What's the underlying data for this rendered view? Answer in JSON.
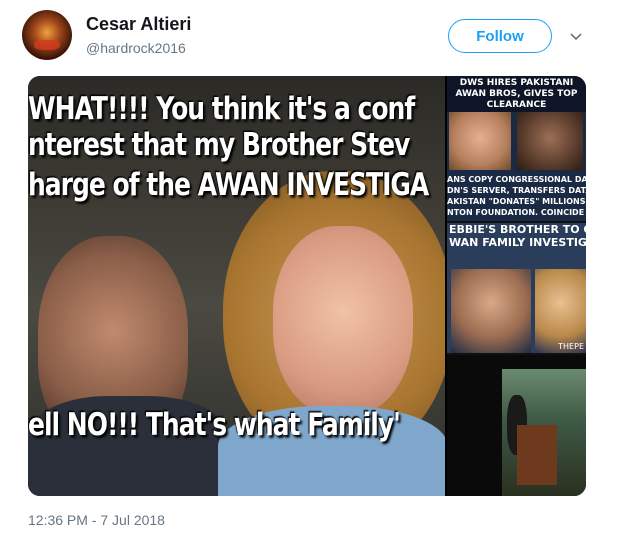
{
  "tweet": {
    "author_name": "Cesar Altieri",
    "author_handle": "@hardrock2016",
    "follow_label": "Follow",
    "timestamp": "12:36 PM - 7 Jul 2018"
  },
  "media": {
    "main_image": {
      "lines": [
        "WHAT!!!! You think it's a conf",
        "nterest that my Brother Stev",
        "harge of the AWAN INVESTIGA",
        "ell NO!!! That's what Family'"
      ]
    },
    "side_image": {
      "panel1_header": "DWS HIRES PAKISTANI AWAN BROS, GIVES TOP CLEARANCE",
      "panel1_captions": [
        "ANS COPY CONGRESSIONAL DATA TO",
        "DN'S SERVER, TRANSFERS DATA TO PA",
        "AKISTAN \"DONATES\" MILLIONS",
        "NTON FOUNDATION. COINCIDE"
      ],
      "panel2_header_lines": [
        "EBBIE'S BROTHER TO OV",
        "WAN FAMILY INVESTIGA"
      ],
      "panel2_source": "THEPE"
    }
  }
}
